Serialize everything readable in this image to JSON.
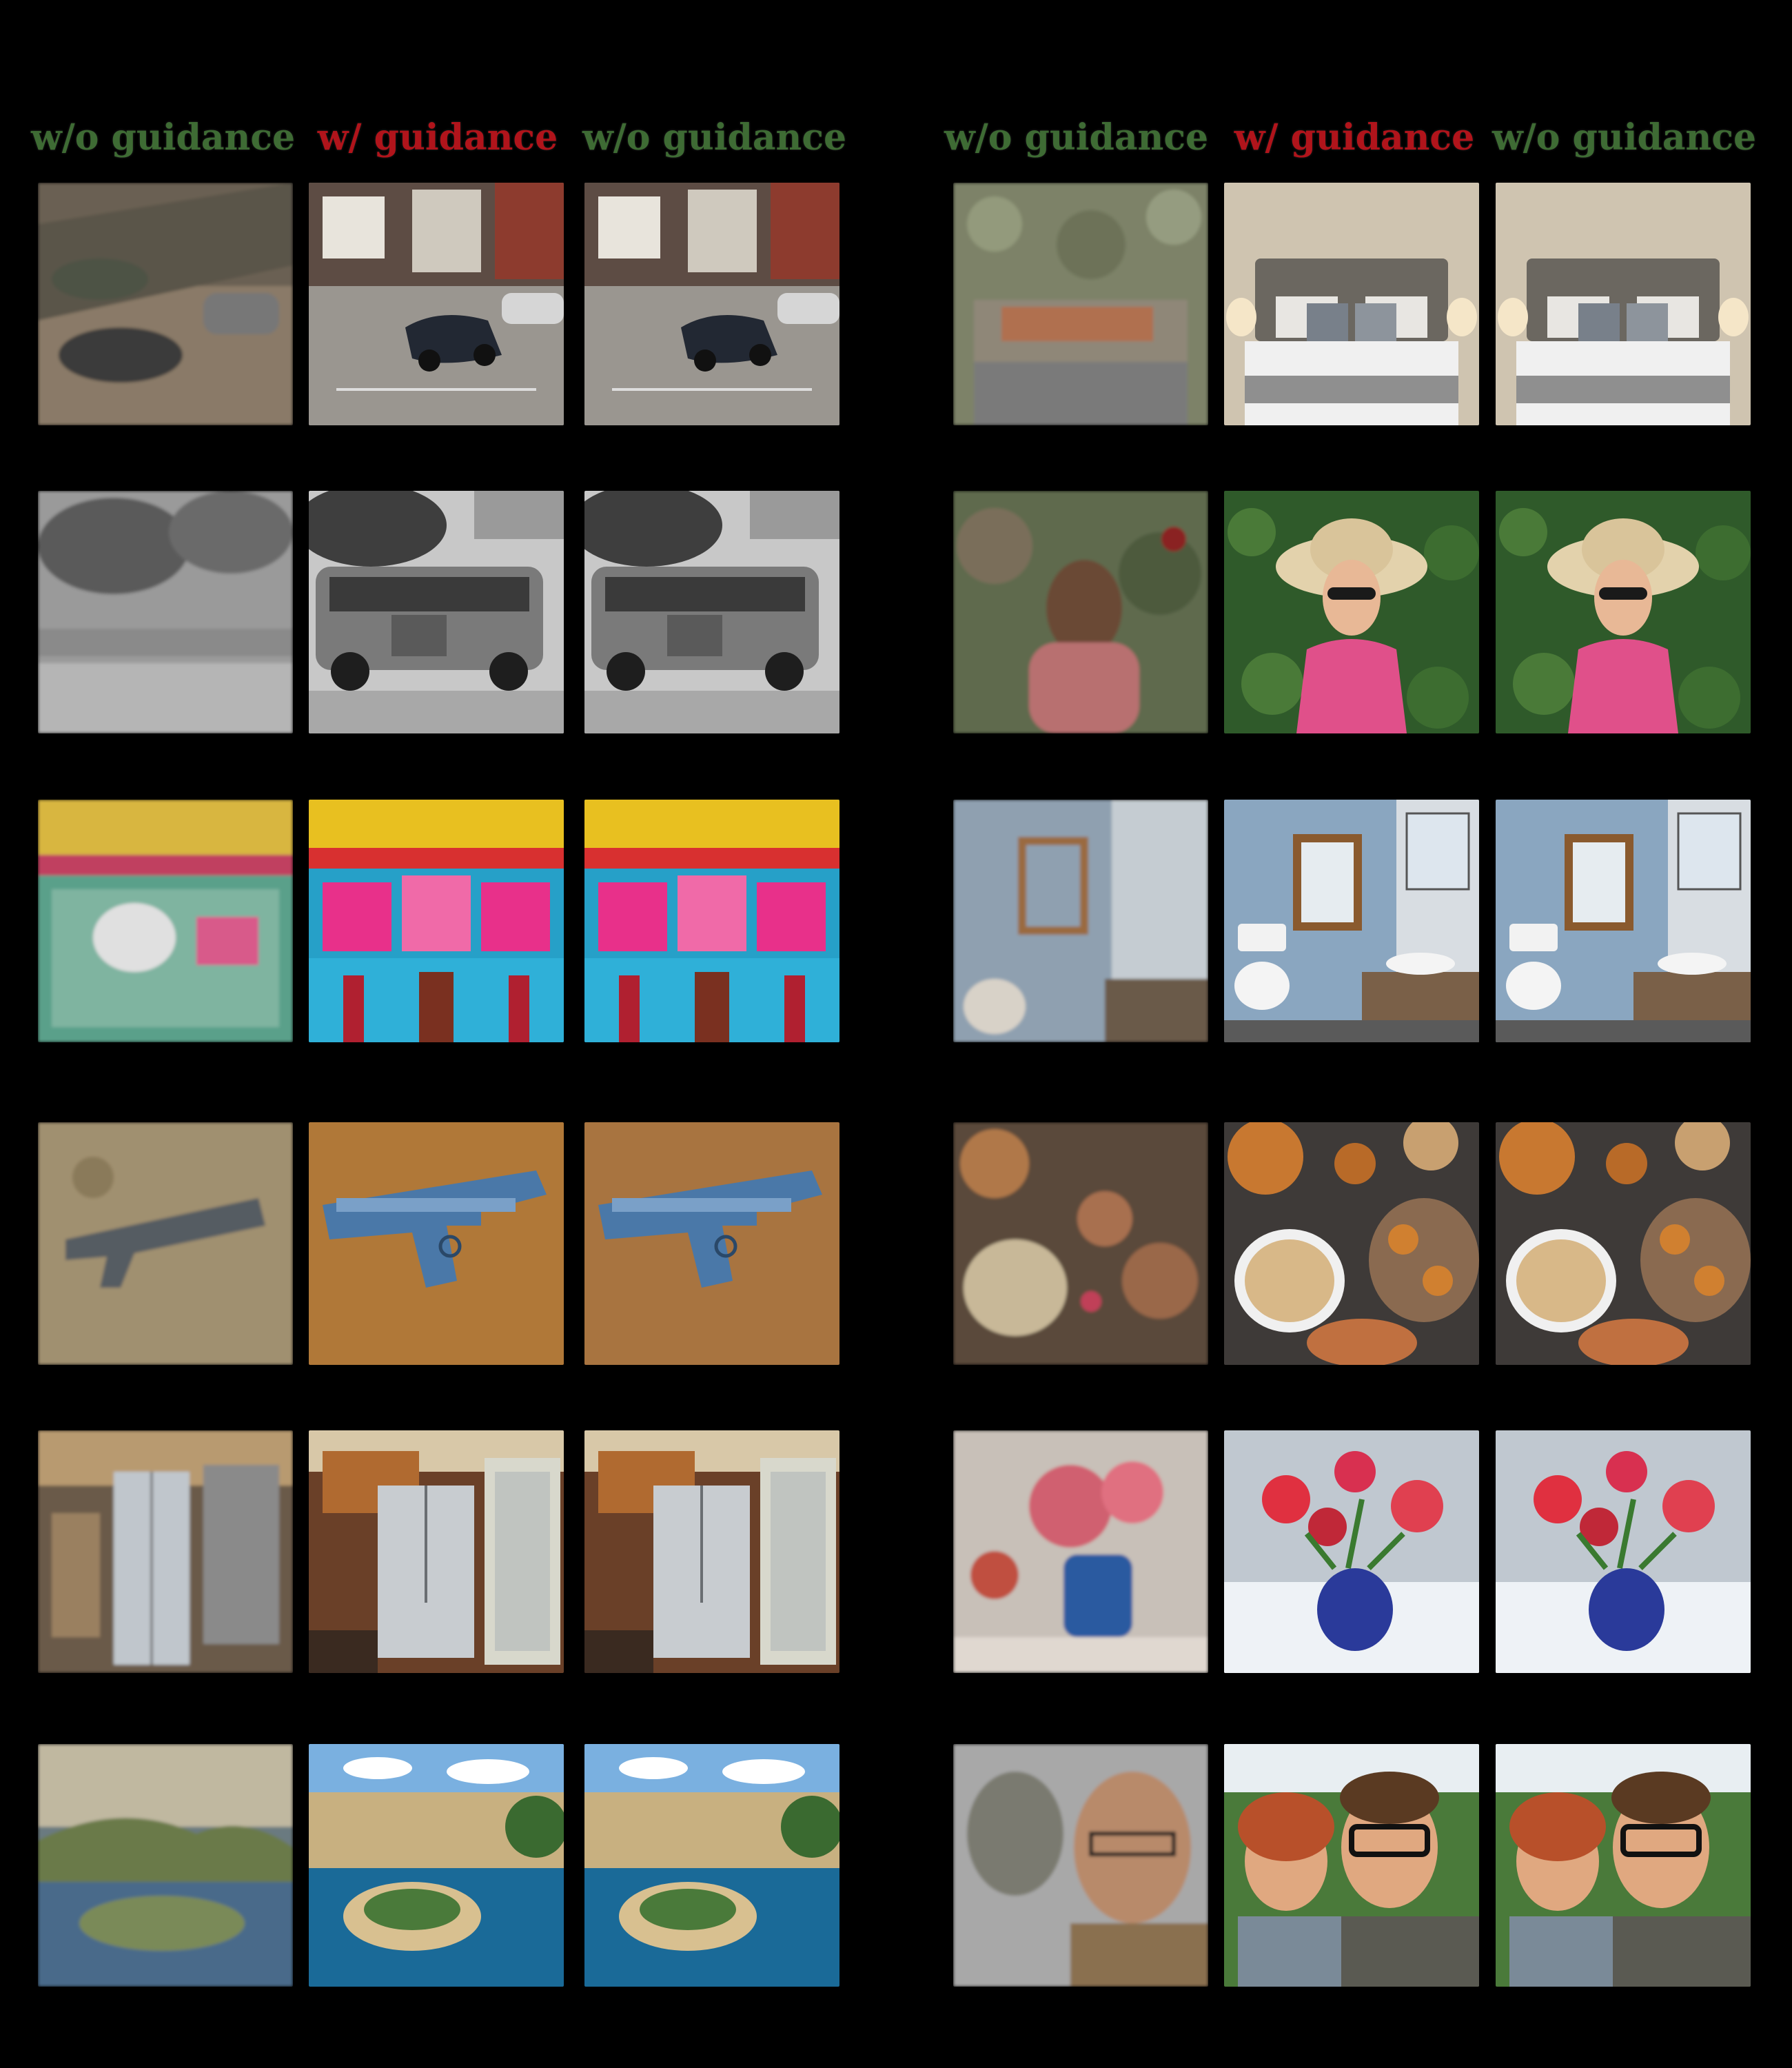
{
  "headers": {
    "left": [
      "w/o guidance",
      "w/ guidance",
      "w/o guidance"
    ],
    "right": [
      "w/o guidance",
      "w/ guidance",
      "w/o guidance"
    ]
  },
  "colors": {
    "background": "#000000",
    "without_guidance_label": "#3e6b34",
    "with_guidance_label": "#b0141b"
  },
  "rows": [
    {
      "left": [
        "car-street-image",
        "car-street-image",
        "car-street-image"
      ],
      "right": [
        "bedroom-image",
        "bedroom-image",
        "bedroom-image"
      ]
    },
    {
      "left": [
        "vintage-bus-image",
        "vintage-bus-image",
        "vintage-bus-image"
      ],
      "right": [
        "woman-sunhat-image",
        "woman-sunhat-image",
        "woman-sunhat-image"
      ]
    },
    {
      "left": [
        "colorful-facade-image",
        "colorful-facade-image",
        "colorful-facade-image"
      ],
      "right": [
        "bathroom-image",
        "bathroom-image",
        "bathroom-image"
      ]
    },
    {
      "left": [
        "pistol-image",
        "pistol-image",
        "pistol-image"
      ],
      "right": [
        "pastries-image",
        "pastries-image",
        "pastries-image"
      ]
    },
    {
      "left": [
        "kitchen-fridge-image",
        "kitchen-fridge-image",
        "kitchen-fridge-image"
      ],
      "right": [
        "flower-vase-snow-image",
        "flower-vase-snow-image",
        "flower-vase-snow-image"
      ]
    },
    {
      "left": [
        "coastal-landscape-image",
        "coastal-landscape-image",
        "coastal-landscape-image"
      ],
      "right": [
        "selfie-people-image",
        "selfie-people-image",
        "selfie-people-image"
      ]
    }
  ]
}
